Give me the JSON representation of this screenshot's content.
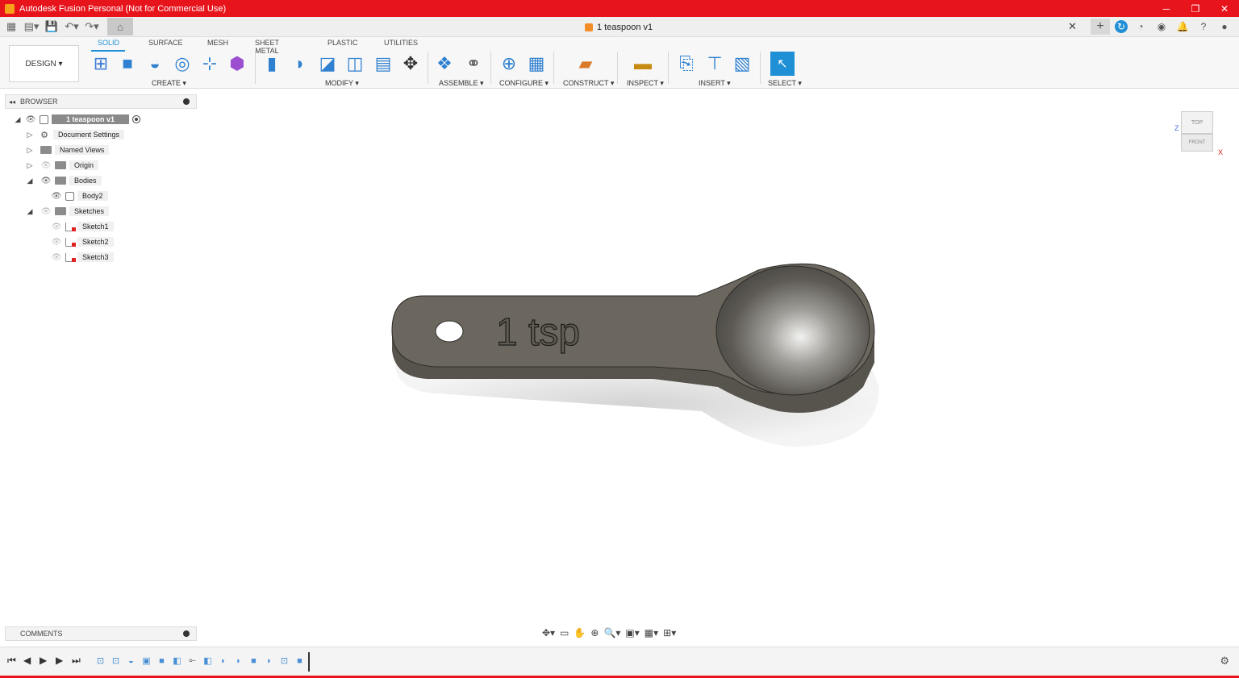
{
  "window": {
    "title": "Autodesk Fusion Personal (Not for Commercial Use)",
    "minimize_icon": "minimize-icon",
    "restore_icon": "restore-icon",
    "close_icon": "close-icon"
  },
  "document": {
    "tab_name": "1 teaspoon v1"
  },
  "ribbon": {
    "workspace_label": "DESIGN ▾",
    "tabs": [
      "SOLID",
      "SURFACE",
      "MESH",
      "SHEET METAL",
      "PLASTIC",
      "UTILITIES"
    ],
    "active_tab": "SOLID",
    "groups": [
      "CREATE ▾",
      "MODIFY ▾",
      "ASSEMBLE ▾",
      "CONFIGURE ▾",
      "CONSTRUCT ▾",
      "INSPECT ▾",
      "INSERT ▾",
      "SELECT ▾"
    ]
  },
  "browser": {
    "title": "BROWSER",
    "root": "1 teaspoon v1",
    "items": [
      {
        "label": "Document Settings"
      },
      {
        "label": "Named Views"
      },
      {
        "label": "Origin"
      },
      {
        "label": "Bodies"
      },
      {
        "label": "Body2"
      },
      {
        "label": "Sketches"
      },
      {
        "label": "Sketch1"
      },
      {
        "label": "Sketch2"
      },
      {
        "label": "Sketch3"
      }
    ]
  },
  "viewcube": {
    "top": "TOP",
    "front": "FRONT",
    "axis_x": "X",
    "axis_z": "Z"
  },
  "model": {
    "engraving": "1 tsp"
  },
  "comments": {
    "title": "COMMENTS"
  },
  "colors": {
    "titlebar": "#e8141c",
    "accent": "#1f8fd6",
    "model_body": "#6b675e"
  }
}
